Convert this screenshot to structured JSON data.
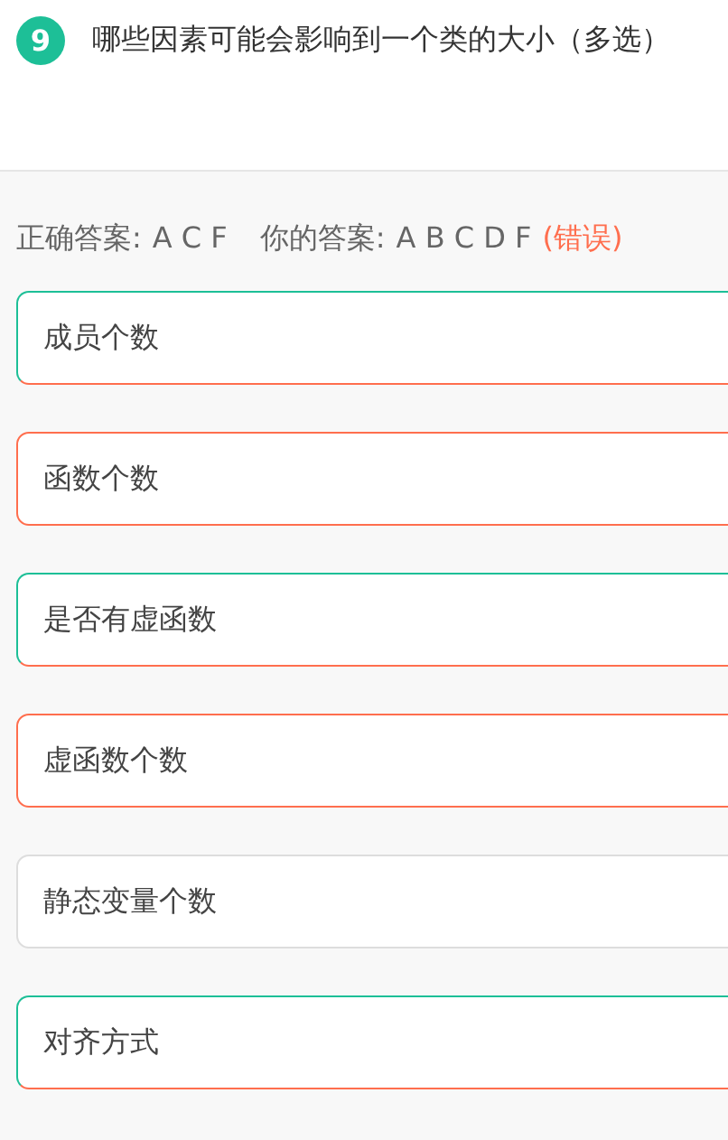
{
  "question": {
    "number": "9",
    "text": "哪些因素可能会影响到一个类的大小（多选）"
  },
  "result": {
    "correct_label": "正确答案:",
    "correct_value": "A C F",
    "your_label": "你的答案:",
    "your_value": "A B C D F",
    "verdict": "(错误)"
  },
  "options": [
    {
      "text": "成员个数",
      "correct": true,
      "chosen": true
    },
    {
      "text": "函数个数",
      "correct": false,
      "chosen": true
    },
    {
      "text": "是否有虚函数",
      "correct": true,
      "chosen": true
    },
    {
      "text": "虚函数个数",
      "correct": false,
      "chosen": true
    },
    {
      "text": "静态变量个数",
      "correct": false,
      "chosen": false
    },
    {
      "text": "对齐方式",
      "correct": true,
      "chosen": true
    }
  ]
}
